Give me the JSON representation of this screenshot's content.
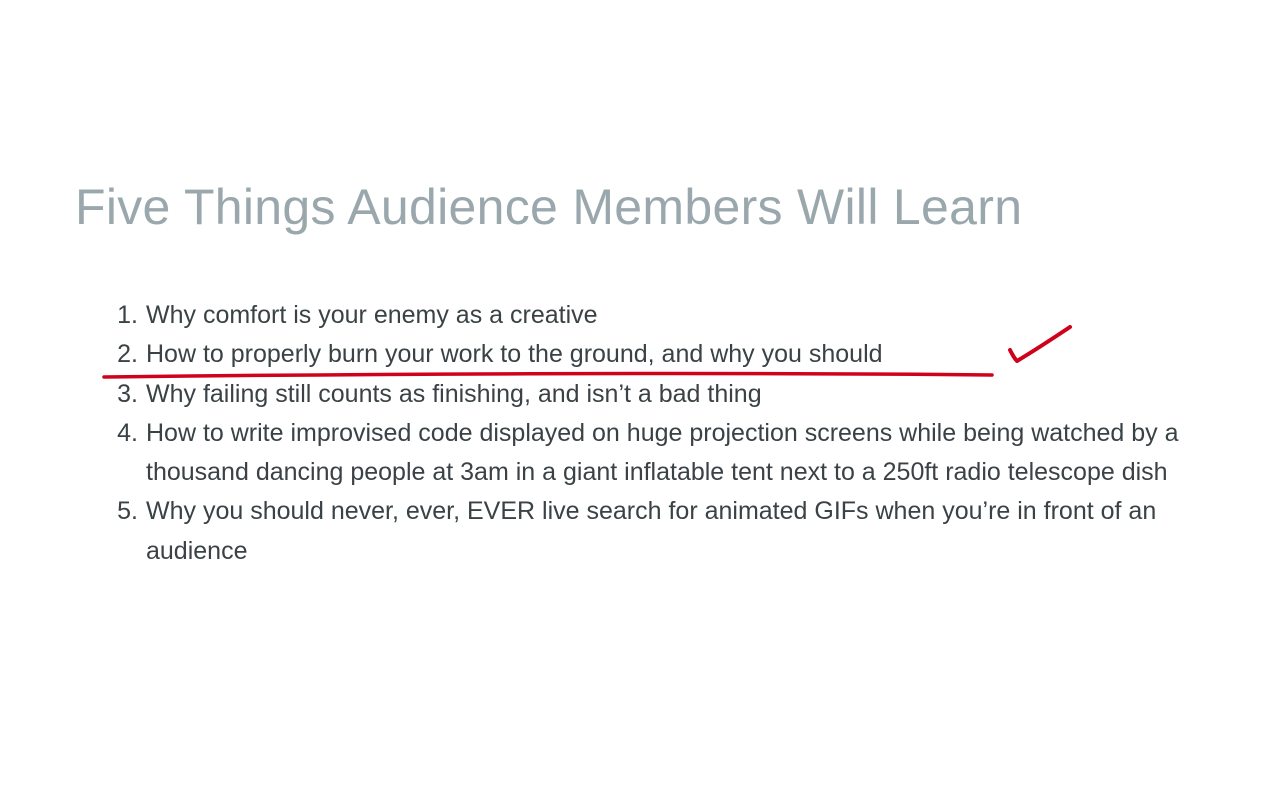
{
  "heading": "Five Things Audience Members Will Learn",
  "items": [
    {
      "number": "1.",
      "text": "Why comfort is your enemy as a creative"
    },
    {
      "number": "2.",
      "text": "How to properly burn your work to the ground, and why you should"
    },
    {
      "number": "3.",
      "text": "Why failing still counts as finishing, and isn’t a bad thing"
    },
    {
      "number": "4.",
      "text": "How to write improvised code displayed on huge projection screens while being watched by a thousand dancing people at 3am in a giant inflatable tent next to a 250ft radio telescope dish"
    },
    {
      "number": "5.",
      "text": "Why you should never, ever, EVER live search for animated GIFs when you’re in front of an audience"
    }
  ],
  "annotation": {
    "color": "#d0021b",
    "underlined_item": 2,
    "check_mark_icon": "check-mark-icon"
  }
}
